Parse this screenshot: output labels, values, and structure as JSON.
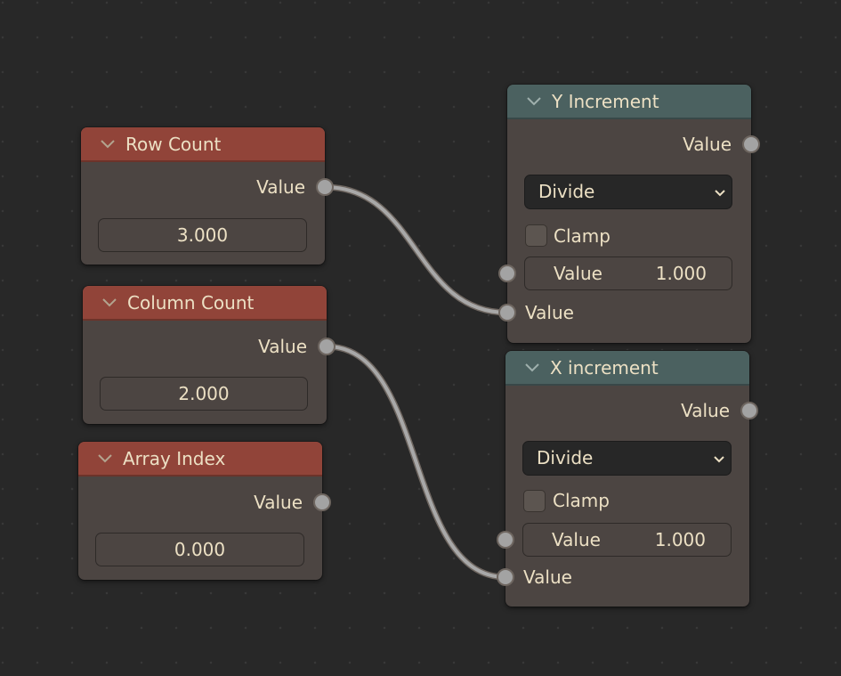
{
  "editor": {
    "type": "node-editor",
    "background_color": "#282828"
  },
  "colors": {
    "input_header": "#914439",
    "converter_header": "#4b6160",
    "node_body": "#4c4542",
    "text": "#ece0c4",
    "socket": "#a3a3a3",
    "link": "#a8a8a8"
  },
  "nodes": {
    "row_count": {
      "title": "Row Count",
      "collapse_icon": "chevron-down-icon",
      "output_label": "Value",
      "value": "3.000"
    },
    "column_count": {
      "title": "Column Count",
      "collapse_icon": "chevron-down-icon",
      "output_label": "Value",
      "value": "2.000"
    },
    "array_index": {
      "title": "Array Index",
      "collapse_icon": "chevron-down-icon",
      "output_label": "Value",
      "value": "0.000"
    },
    "y_increment": {
      "title": "Y Increment",
      "collapse_icon": "chevron-down-icon",
      "output_label": "Value",
      "operation": "Divide",
      "clamp_label": "Clamp",
      "clamp_checked": false,
      "input_a_label": "Value",
      "input_a_value": "1.000",
      "input_b_label": "Value"
    },
    "x_increment": {
      "title": "X increment",
      "collapse_icon": "chevron-down-icon",
      "output_label": "Value",
      "operation": "Divide",
      "clamp_label": "Clamp",
      "clamp_checked": false,
      "input_a_label": "Value",
      "input_a_value": "1.000",
      "input_b_label": "Value"
    }
  },
  "links": [
    {
      "from": "row_count.Value",
      "to": "y_increment.Value (input 2)"
    },
    {
      "from": "column_count.Value",
      "to": "x_increment.Value (input 2)"
    }
  ]
}
